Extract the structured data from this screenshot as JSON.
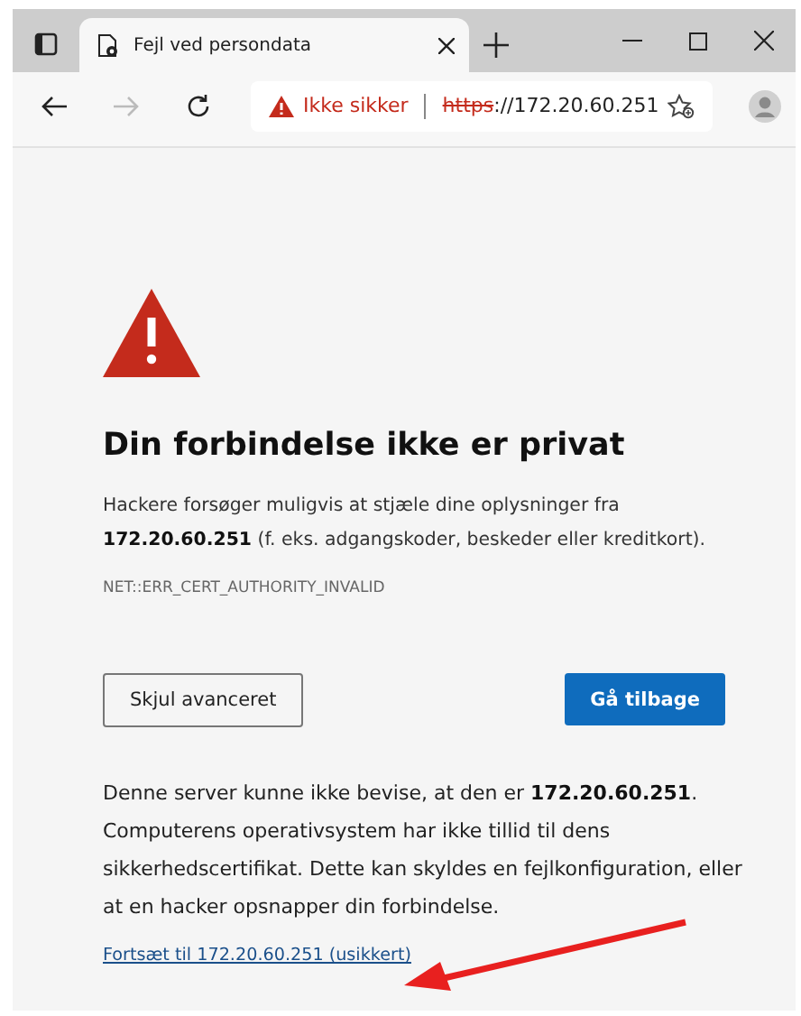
{
  "browser": {
    "tabs": [
      {
        "title": "Fejl ved persondata",
        "selected": true
      }
    ],
    "address_bar": {
      "security_label": "Ikke sikker",
      "scheme": "https",
      "rest": "://172.20.60.251"
    }
  },
  "page": {
    "heading": "Din forbindelse ikke er privat",
    "intro": "Hackere forsøger muligvis at stjæle dine oplysninger fra **172.20.60.251** (f. eks. adgangskoder, beskeder eller kreditkort).",
    "error_code": "NET::ERR_CERT_AUTHORITY_INVALID",
    "buttons": [
      {
        "label": "Skjul avanceret",
        "kind": "secondary"
      },
      {
        "label": "Gå tilbage",
        "kind": "primary"
      }
    ],
    "details": "Denne server kunne ikke bevise, at den er **172.20.60.251**. Computerens operativsystem har ikke tillid til dens sikkerhedscertifikat. Dette kan skyldes en fejlkonfiguration, eller at en hacker opsnapper din forbindelse.",
    "proceed_link": "Fortsæt til 172.20.60.251 (usikkert)"
  }
}
